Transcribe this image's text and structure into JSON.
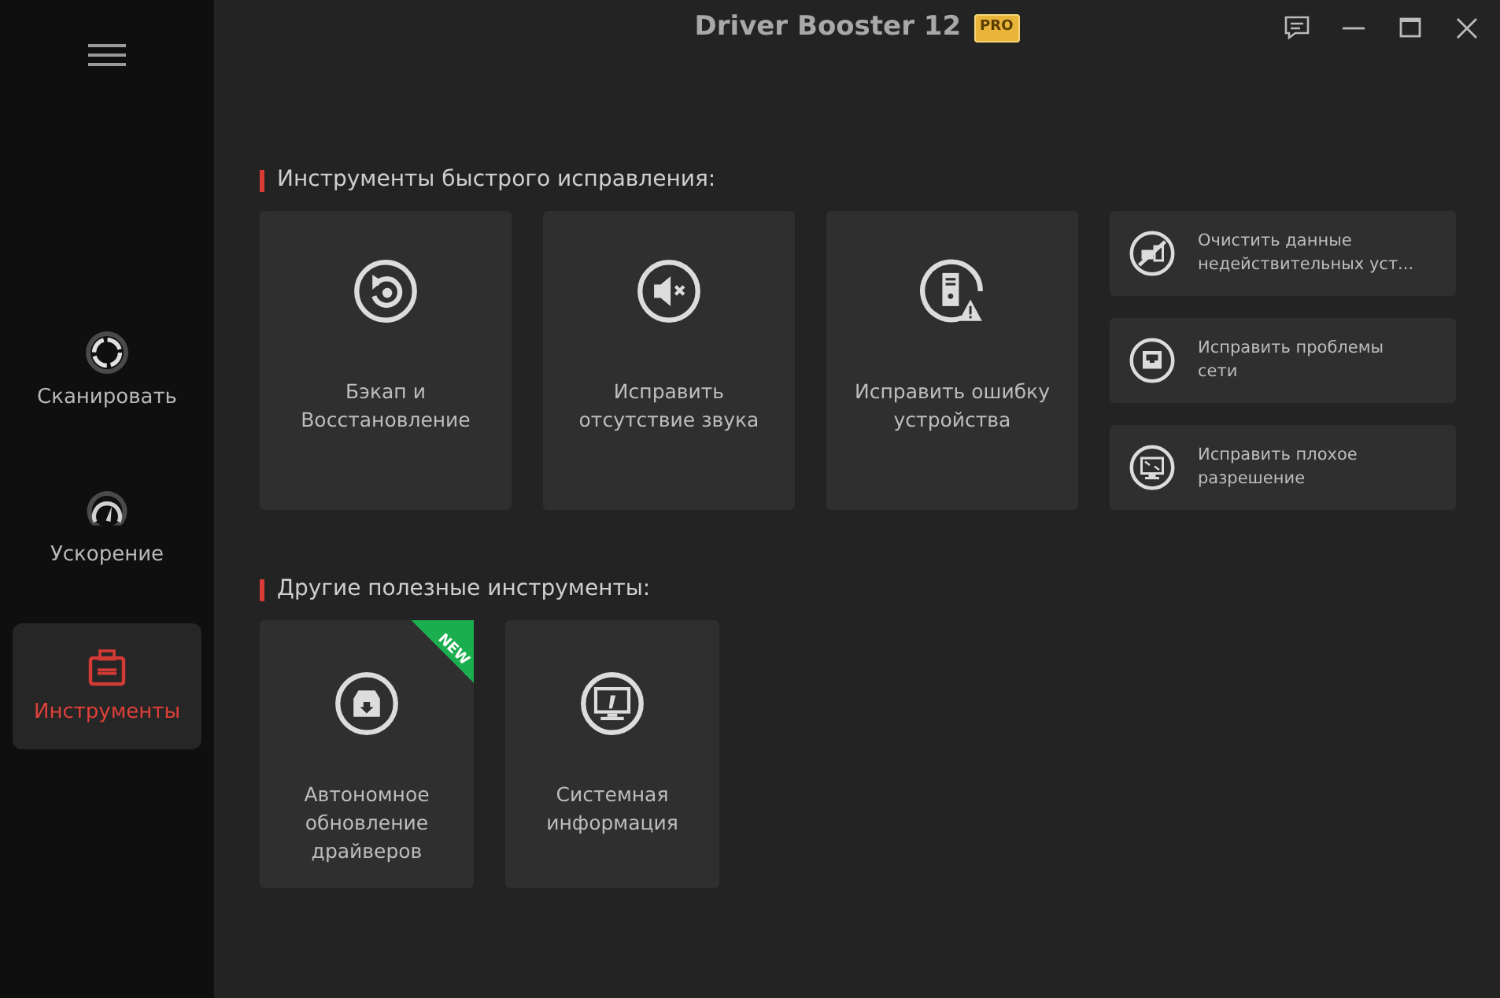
{
  "window": {
    "title": "Driver Booster 12",
    "edition_badge": "PRO"
  },
  "sidebar": {
    "items": [
      {
        "label": "Сканировать",
        "selected": false
      },
      {
        "label": "Ускорение",
        "selected": false
      },
      {
        "label": "Инструменты",
        "selected": true
      }
    ]
  },
  "sections": [
    {
      "heading": "Инструменты быстрого исправления:",
      "tools": [
        {
          "kind": "large",
          "label": "Бэкап и\nВосстановление"
        },
        {
          "kind": "large",
          "label": "Исправить\nотсутствие звука"
        },
        {
          "kind": "large",
          "label": "Исправить ошибку\nустройства"
        }
      ],
      "compact_tools": [
        {
          "label": "Очистить данные\nнедействительных уст..."
        },
        {
          "label": "Исправить проблемы\nсети"
        },
        {
          "label": "Исправить плохое\nразрешение"
        }
      ]
    },
    {
      "heading": "Другие полезные инструменты:",
      "tools": [
        {
          "kind": "medium",
          "label": "Автономное\nобновление\nдрайверов",
          "badge": "NEW"
        },
        {
          "kind": "medium",
          "label": "Системная\nинформация"
        }
      ]
    }
  ]
}
